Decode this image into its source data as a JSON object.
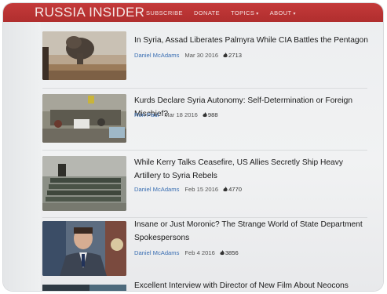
{
  "header": {
    "logo": "RUSSIA INSIDER",
    "nav": [
      {
        "label": "SUBSCRIBE"
      },
      {
        "label": "DONATE"
      },
      {
        "label": "TOPICS",
        "caret": "▾"
      },
      {
        "label": "ABOUT",
        "caret": "▾"
      }
    ]
  },
  "articles": [
    {
      "title": "In Syria, Assad Liberates Palmyra While CIA Battles the Pentagon",
      "author": "Daniel McAdams",
      "date": "Mar 30 2016",
      "views": "2713"
    },
    {
      "title": "Kurds Declare Syria Autonomy: Self-Determination or Foreign Mischief?",
      "author": "Ron Paul",
      "date": "Mar 18 2016",
      "views": "988"
    },
    {
      "title": "While Kerry Talks Ceasefire, US Allies Secretly Ship Heavy Artillery to Syria Rebels",
      "author": "Daniel McAdams",
      "date": "Feb 15 2016",
      "views": "4770"
    },
    {
      "title": "Insane or Just Moronic? The Strange World of State Department Spokespersons",
      "author": "Daniel McAdams",
      "date": "Feb 4 2016",
      "views": "3856"
    },
    {
      "title": "Excellent Interview with Director of New Film About Neocons (Video)"
    }
  ],
  "colors": {
    "navbar": "#b83333",
    "author_link": "#3b6fb3"
  }
}
